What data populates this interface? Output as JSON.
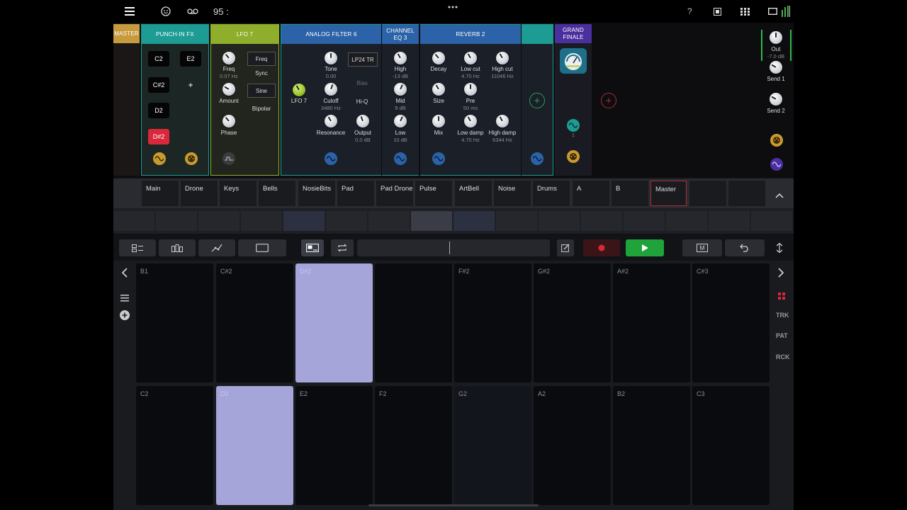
{
  "status": {
    "tempo": "95 :"
  },
  "master_label": "MASTER",
  "punch_in": {
    "title": "PUNCH-IN FX",
    "notes": [
      {
        "label": "C2",
        "active": false
      },
      {
        "label": "E2",
        "active": false
      },
      {
        "label": "C#2",
        "active": false
      },
      {
        "label": "+",
        "active": false
      },
      {
        "label": "D2",
        "active": false
      },
      {
        "label": "D#2",
        "active": true
      }
    ],
    "color": "#1c9c93"
  },
  "lfo7": {
    "title": "LFO 7",
    "color": "#8fae2c",
    "knobs": [
      {
        "label": "Freq",
        "value": "0.07 Hz"
      },
      {
        "label": "Amount",
        "value": ""
      },
      {
        "label": "Phase",
        "value": ""
      }
    ],
    "freq_btn": "Freq",
    "sync_label": "Sync",
    "shape_btn": "Sine",
    "bipolar_label": "Bipolar"
  },
  "analog_filter": {
    "title": "ANALOG FILTER 6",
    "color": "#2c62a8",
    "lfo_label": "LFO 7",
    "mode_btn": "LP24 TR",
    "bias_label": "Bias",
    "hiq_label": "Hi-Q",
    "knobs": [
      {
        "label": "Tone",
        "value": "0.00"
      },
      {
        "label": "Cutoff",
        "value": "3480 Hz"
      },
      {
        "label": "Resonance",
        "value": ""
      },
      {
        "label": "Output",
        "value": "0.0 dB"
      }
    ]
  },
  "channel_eq": {
    "title": "CHANNEL EQ 3",
    "color": "#2c62a8",
    "knobs": [
      {
        "label": "High",
        "value": "-13 dB"
      },
      {
        "label": "Mid",
        "value": "9 dB"
      },
      {
        "label": "Low",
        "value": "10 dB"
      }
    ]
  },
  "reverb": {
    "title": "REVERB 2",
    "color": "#2c62a8",
    "knobs": [
      {
        "label": "Decay",
        "value": ""
      },
      {
        "label": "Low cut",
        "value": "4.70 Hz"
      },
      {
        "label": "High cut",
        "value": "11046 Hz"
      },
      {
        "label": "Size",
        "value": ""
      },
      {
        "label": "Pre",
        "value": "50 ms"
      },
      {
        "label": "Mix",
        "value": ""
      },
      {
        "label": "Low damp",
        "value": "4.70 Hz"
      },
      {
        "label": "High damp",
        "value": "6344 Hz"
      }
    ]
  },
  "grand_finale": {
    "title": "GRAND FINALE",
    "color": "#4a2f9e",
    "sub_label": "1"
  },
  "master_out": {
    "out_label": "Out",
    "out_value": "-7.0 dB",
    "send1": "Send 1",
    "send2": "Send 2"
  },
  "tracks": [
    "Main",
    "Drone",
    "Keys",
    "Bells",
    "NosieBits",
    "Pad",
    "Pad Drone",
    "Pulse",
    "ArtBell",
    "Noise",
    "Drums",
    "A",
    "B",
    "Master",
    "",
    ""
  ],
  "side_labels": {
    "trk": "TRK",
    "pat": "PAT",
    "rck": "RCK",
    "toolbar_m": "M"
  },
  "pads_top": [
    {
      "label": "B1",
      "active": false
    },
    {
      "label": "C#2",
      "active": false
    },
    {
      "label": "D#2",
      "active": true
    },
    {
      "label": "",
      "active": false
    },
    {
      "label": "F#2",
      "active": false
    },
    {
      "label": "G#2",
      "active": false
    },
    {
      "label": "A#2",
      "active": false
    },
    {
      "label": "C#3",
      "active": false
    }
  ],
  "pads_bottom": [
    {
      "label": "C2",
      "active": false
    },
    {
      "label": "D2",
      "active": true
    },
    {
      "label": "E2",
      "active": false
    },
    {
      "label": "F2",
      "active": false
    },
    {
      "label": "G2",
      "active": false
    },
    {
      "label": "A2",
      "active": false
    },
    {
      "label": "B2",
      "active": false
    },
    {
      "label": "C3",
      "active": false
    }
  ],
  "colors": {
    "play": "#1fa33a",
    "record": "#8a1c20",
    "note_active": "#d8283a"
  }
}
